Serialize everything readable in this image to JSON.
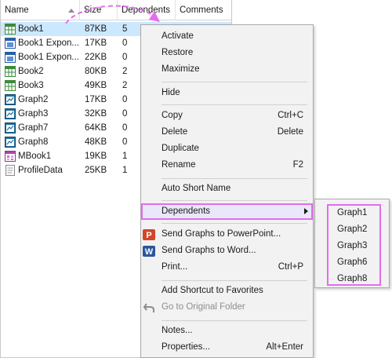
{
  "filelist": {
    "columns": {
      "name": "Name",
      "size": "Size",
      "dependents": "Dependents",
      "comments": "Comments"
    },
    "rows": [
      {
        "name": "Book1",
        "size": "87KB",
        "dependents": "5",
        "icon": "workbook-icon",
        "selected": true
      },
      {
        "name": "Book1 Expon...",
        "size": "17KB",
        "dependents": "0",
        "icon": "matrix-book-icon"
      },
      {
        "name": "Book1 Expon...",
        "size": "22KB",
        "dependents": "0",
        "icon": "matrix-book-icon"
      },
      {
        "name": "Book2",
        "size": "80KB",
        "dependents": "2",
        "icon": "workbook-icon"
      },
      {
        "name": "Book3",
        "size": "49KB",
        "dependents": "2",
        "icon": "workbook-icon"
      },
      {
        "name": "Graph2",
        "size": "17KB",
        "dependents": "0",
        "icon": "graph-icon"
      },
      {
        "name": "Graph3",
        "size": "32KB",
        "dependents": "0",
        "icon": "graph-icon"
      },
      {
        "name": "Graph7",
        "size": "64KB",
        "dependents": "0",
        "icon": "graph-icon"
      },
      {
        "name": "Graph8",
        "size": "48KB",
        "dependents": "0",
        "icon": "graph-icon"
      },
      {
        "name": "MBook1",
        "size": "19KB",
        "dependents": "1",
        "icon": "matrix-workbook-icon"
      },
      {
        "name": "ProfileData",
        "size": "25KB",
        "dependents": "1",
        "icon": "notes-icon"
      }
    ]
  },
  "context_menu": {
    "activate": "Activate",
    "restore": "Restore",
    "maximize": "Maximize",
    "hide": "Hide",
    "copy": "Copy",
    "copy_shortcut": "Ctrl+C",
    "delete": "Delete",
    "delete_shortcut": "Delete",
    "duplicate": "Duplicate",
    "rename": "Rename",
    "rename_shortcut": "F2",
    "auto_short_name": "Auto Short Name",
    "dependents": "Dependents",
    "send_ppt": "Send Graphs to PowerPoint...",
    "send_word": "Send Graphs to Word...",
    "print": "Print...",
    "print_shortcut": "Ctrl+P",
    "add_shortcut": "Add Shortcut to Favorites",
    "go_original": "Go to Original Folder",
    "notes": "Notes...",
    "properties": "Properties...",
    "properties_shortcut": "Alt+Enter"
  },
  "submenu": {
    "items": [
      "Graph1",
      "Graph2",
      "Graph3",
      "Graph6",
      "Graph8"
    ]
  },
  "colors": {
    "selection": "#cce8ff",
    "annotation": "#e36cf0",
    "menu_bg": "#f2f2f2"
  }
}
